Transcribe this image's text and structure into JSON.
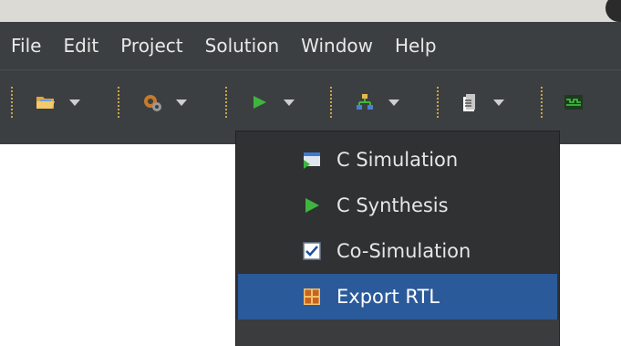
{
  "menubar": {
    "items": [
      {
        "label": "File"
      },
      {
        "label": "Edit"
      },
      {
        "label": "Project"
      },
      {
        "label": "Solution"
      },
      {
        "label": "Window"
      },
      {
        "label": "Help"
      }
    ]
  },
  "toolbar": {
    "tools": [
      {
        "icon": "open-folder-icon"
      },
      {
        "icon": "settings-gears-icon"
      },
      {
        "icon": "run-play-icon"
      },
      {
        "icon": "hierarchy-icon"
      },
      {
        "icon": "clipboard-icon"
      },
      {
        "icon": "waveform-icon"
      }
    ]
  },
  "dropdown": {
    "items": [
      {
        "label": "C Simulation",
        "icon": "simulation-window-icon",
        "selected": false
      },
      {
        "label": "C Synthesis",
        "icon": "green-play-icon",
        "selected": false
      },
      {
        "label": "Co-Simulation",
        "icon": "checkbox-checked-icon",
        "selected": false
      },
      {
        "label": "Export RTL",
        "icon": "export-grid-icon",
        "selected": true
      }
    ]
  },
  "colors": {
    "menubar_bg": "#3c3f41",
    "dropdown_bg": "#2f3133",
    "selected_bg": "#2b5a9a",
    "play_green": "#3fb53f"
  }
}
